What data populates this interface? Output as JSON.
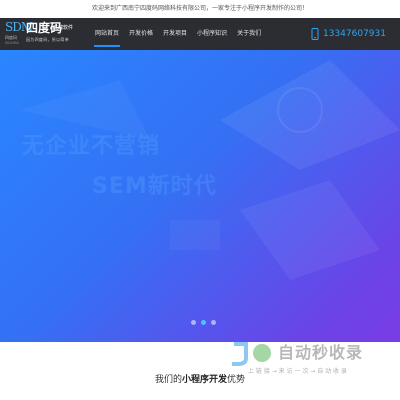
{
  "topbar": {
    "welcome": "欢迎来到广西南宁四度码网络科技有限公司，一家专注于小程序开发制作的公司！"
  },
  "header": {
    "logo": {
      "mark": "SDM",
      "mark_sub": "四度码",
      "mark_en": "SIDUMA",
      "name": "四度码",
      "name_sub": "高端软件",
      "tagline": "因为四度码，所以简单"
    },
    "nav": [
      {
        "label": "网站首页",
        "active": true
      },
      {
        "label": "开发价格",
        "active": false
      },
      {
        "label": "开发项目",
        "active": false
      },
      {
        "label": "小程序知识",
        "active": false
      },
      {
        "label": "关于我们",
        "active": false
      }
    ],
    "phone": "13347607931"
  },
  "banner": {
    "line1": "无企业不营销",
    "line2": "SEM新时代",
    "slides": 3,
    "active_slide": 2
  },
  "section": {
    "title_prefix": "我们的",
    "title_highlight": "小程序开发",
    "title_suffix": "优势"
  },
  "watermark": {
    "text": "自动秒收录",
    "sub": "上 链 接 → 来 访 一 次 → 自 动 收 录"
  },
  "colors": {
    "nav_bg": "#2b2d33",
    "accent": "#1e90ff",
    "phone": "#2aa6f5",
    "banner_start": "#2a86ff",
    "banner_end": "#7a3ce6"
  },
  "icons": [
    "phone-icon",
    "slider-dot"
  ]
}
